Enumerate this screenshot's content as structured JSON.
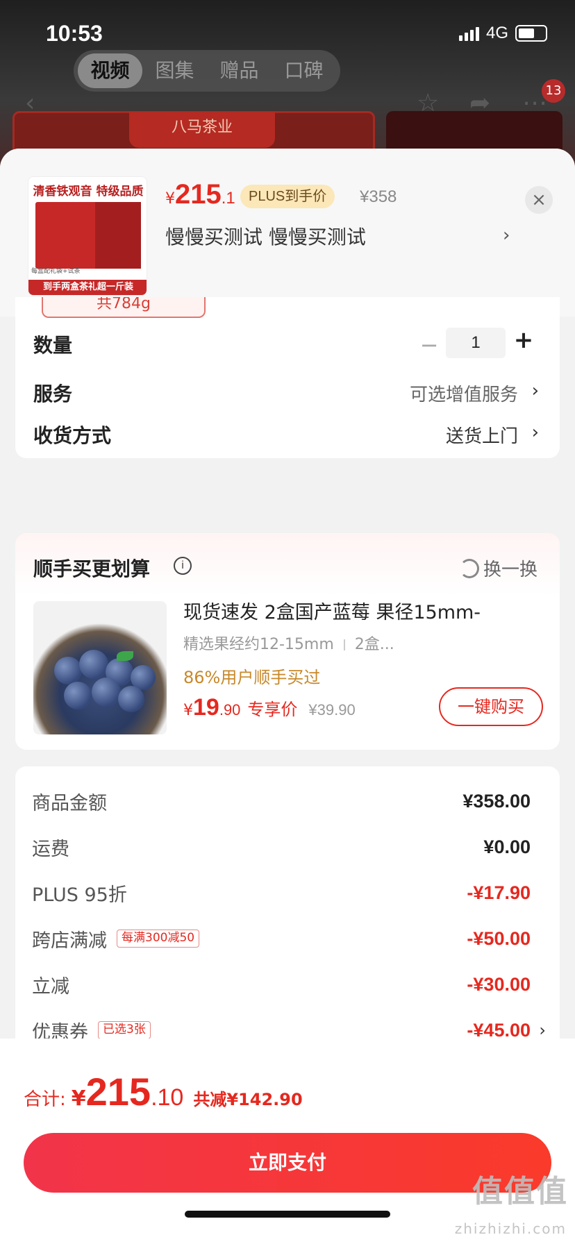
{
  "status_bar": {
    "time": "10:53",
    "network": "4G"
  },
  "media_tabs": [
    "视频",
    "图集",
    "赠品",
    "口碑"
  ],
  "background": {
    "cart_badge": "13",
    "brand_banner": "八马茶业"
  },
  "header": {
    "thumbnail_title": "清香铁观音 特级品质",
    "thumbnail_sub": "每盒配礼袋+试茶",
    "thumbnail_footer": "到手两盒茶礼超一斤装",
    "price_currency": "¥",
    "price_int": "215",
    "price_dec": ".1",
    "plus_tag": "PLUS到手价",
    "original_price": "¥358",
    "spec_text": "慢慢买测试  慢慢买测试",
    "close_label": "×"
  },
  "selection": {
    "spec_chip": "共784g",
    "quantity_label": "数量",
    "quantity_value": "1",
    "service_label": "服务",
    "service_value": "可选增值服务",
    "delivery_label": "收货方式",
    "delivery_value": "送货上门"
  },
  "addon": {
    "title": "顺手买更划算",
    "swap_label": "换一换",
    "product_title": "现货速发 2盒国产蓝莓 果径15mm-",
    "product_sub_a": "精选果经约12-15mm",
    "product_sub_b": "2盒...",
    "rate_text": "86%用户顺手买过",
    "price_currency": "¥",
    "price_int": "19",
    "price_dec": ".90",
    "price_label": "专享价",
    "original_price": "¥39.90",
    "buy_button": "一键购买"
  },
  "summary": {
    "rows": [
      {
        "label": "商品金额",
        "amount": "¥358.00"
      },
      {
        "label": "运费",
        "amount": "¥0.00"
      },
      {
        "label": "PLUS 95折",
        "amount": "-¥17.90"
      },
      {
        "label": "跨店满减",
        "tag": "每满300减50",
        "amount": "-¥50.00"
      },
      {
        "label": "立减",
        "amount": "-¥30.00"
      },
      {
        "label": "优惠券",
        "tag": "已选3张",
        "amount": "-¥45.00"
      }
    ]
  },
  "footer": {
    "total_label": "合计:",
    "total_currency": "¥",
    "total_int": "215",
    "total_dec": ".10",
    "total_saved": "共减¥142.90",
    "pay_button": "立即支付"
  },
  "watermark": {
    "main": "值值值",
    "sub": "zhizhizhi.com"
  },
  "colors": {
    "accent": "#e5281f",
    "plus_tag_bg": "#fbe7b8",
    "rate_text": "#c8882a"
  }
}
